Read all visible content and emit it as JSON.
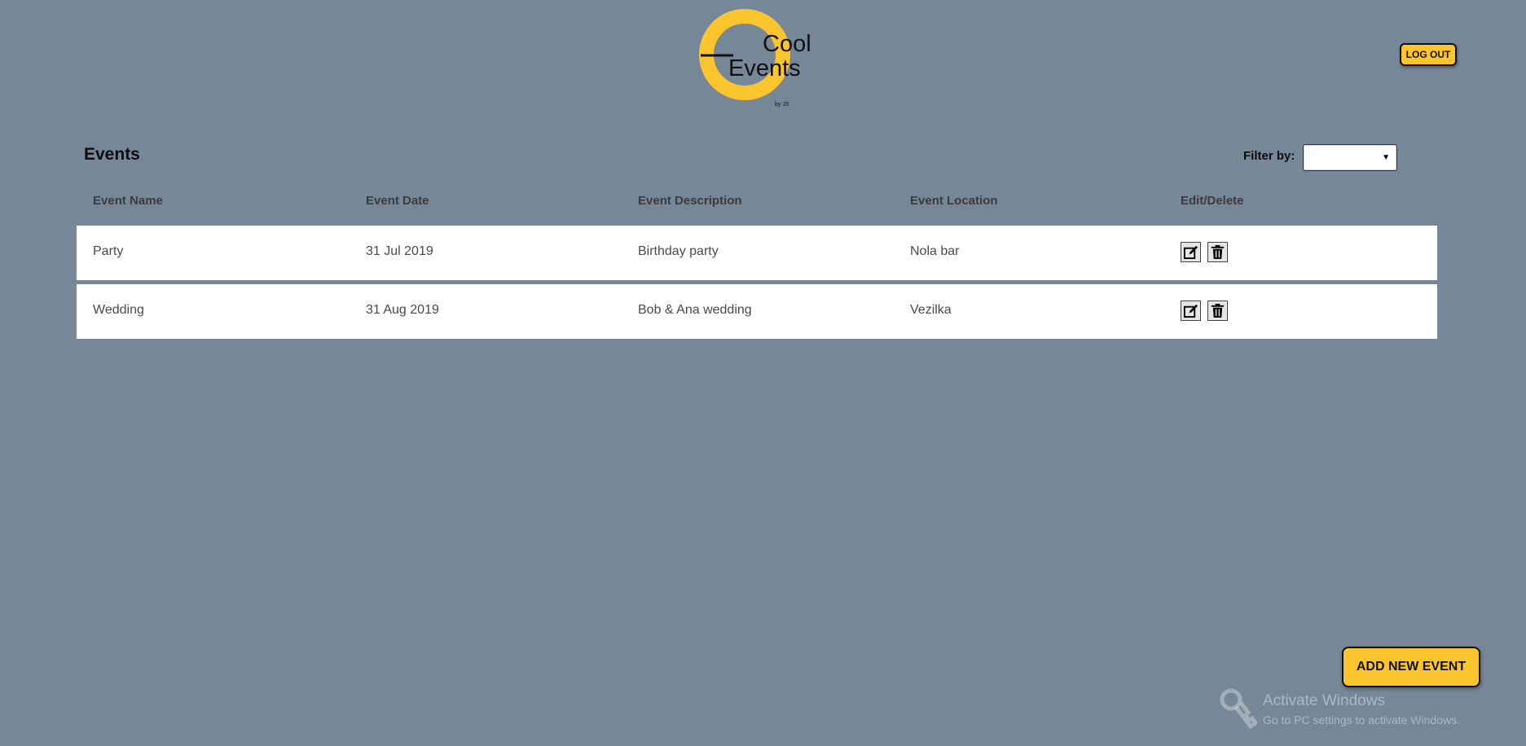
{
  "header": {
    "logo_text_line1": "Cool",
    "logo_text_line2": "Events",
    "logo_byline": "by JS",
    "logout_label": "LOG OUT"
  },
  "page": {
    "title": "Events",
    "filter_label": "Filter by:",
    "filter_value": ""
  },
  "table": {
    "columns": [
      "Event Name",
      "Event Date",
      "Event Description",
      "Event Location",
      "Edit/Delete"
    ],
    "rows": [
      {
        "name": "Party",
        "date": "31 Jul 2019",
        "description": "Birthday party",
        "location": "Nola bar"
      },
      {
        "name": "Wedding",
        "date": "31 Aug 2019",
        "description": "Bob & Ana wedding",
        "location": "Vezilka"
      }
    ]
  },
  "actions": {
    "add_label": "ADD NEW EVENT",
    "edit_icon": "edit-icon",
    "delete_icon": "trash-icon"
  },
  "watermark": {
    "title": "Activate Windows",
    "subtitle": "Go to PC settings to activate Windows."
  },
  "colors": {
    "background": "#768797",
    "accent": "#fcc52e",
    "row_background": "#ffffff"
  }
}
